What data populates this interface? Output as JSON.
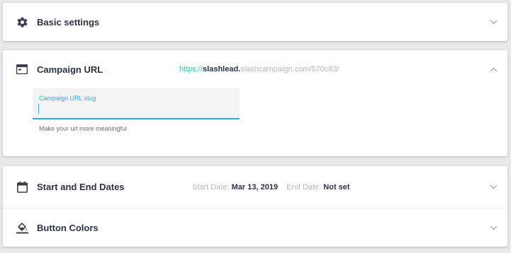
{
  "sections": {
    "basic": {
      "title": "Basic settings",
      "icon": "gear-icon"
    },
    "campaign_url": {
      "title": "Campaign URL",
      "icon": "browser-window-icon",
      "url_protocol": "https://",
      "url_subdomain": "slashlead.",
      "url_rest": "slashcampaign.com/570c83/",
      "slug_label": "Campaign URL slug",
      "slug_value": "",
      "slug_helper": "Make your url more meaningful"
    },
    "dates": {
      "title": "Start and End Dates",
      "icon": "calendar-icon",
      "start_label": "Start Date:",
      "start_value": "Mar 13, 2019",
      "end_label": "End Date:",
      "end_value": "Not set"
    },
    "button_colors": {
      "title": "Button Colors",
      "icon": "paint-bucket-icon"
    }
  },
  "colors": {
    "accent": "#2eaee6",
    "protocol_green": "#3bc4a6",
    "title_text": "#2d3145",
    "muted_text": "#b3b7c2"
  }
}
